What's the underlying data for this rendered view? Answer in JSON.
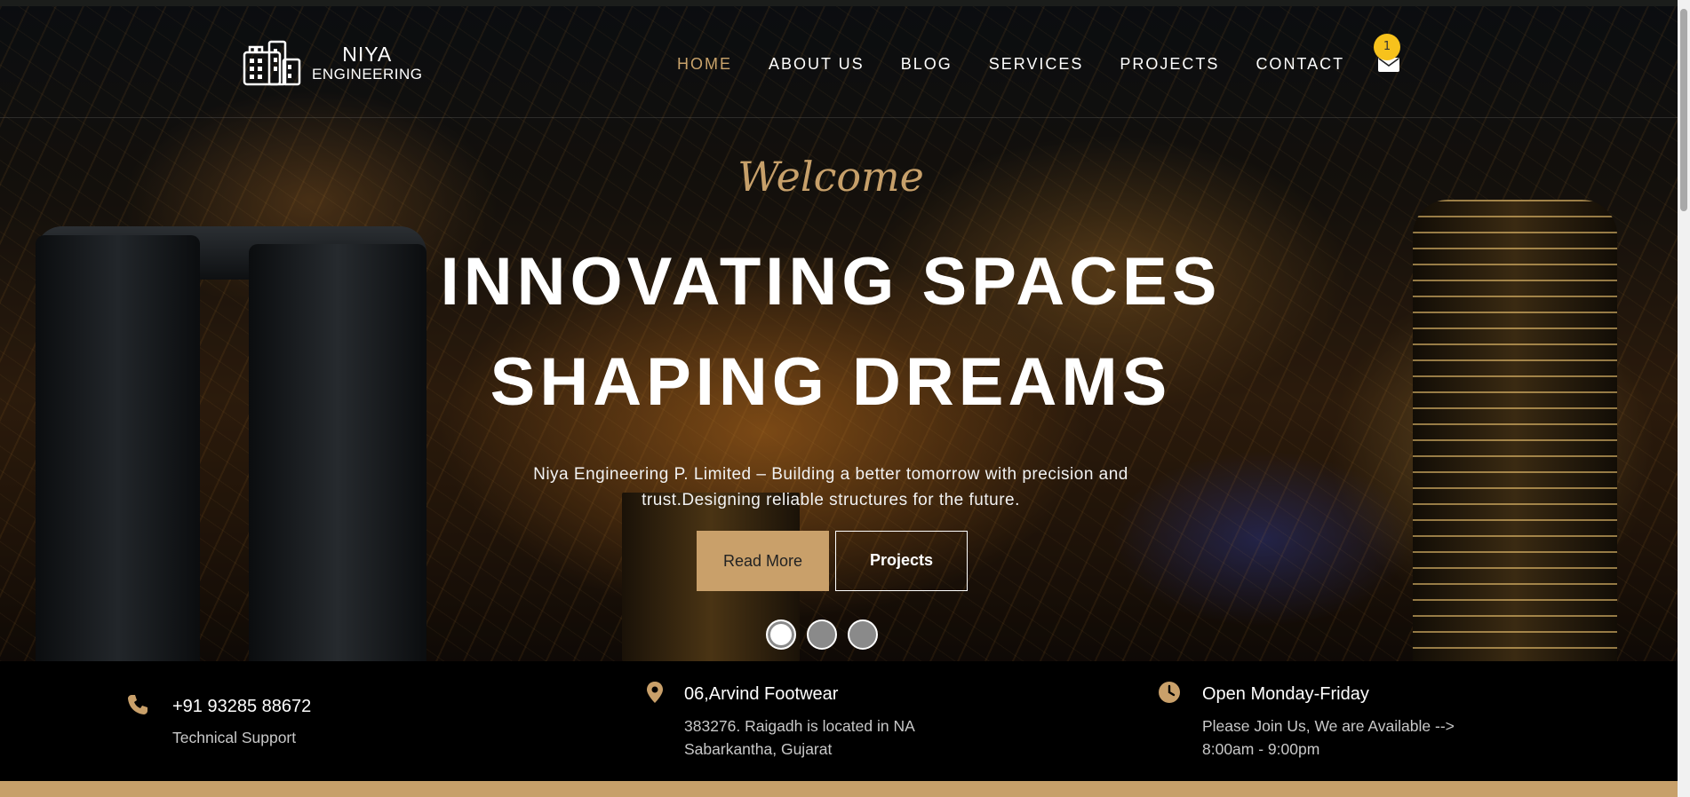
{
  "brand": {
    "name": "NIYA",
    "sub": "ENGINEERING"
  },
  "nav": {
    "items": [
      {
        "label": "HOME",
        "active": true
      },
      {
        "label": "ABOUT US"
      },
      {
        "label": "BLOG"
      },
      {
        "label": "SERVICES"
      },
      {
        "label": "PROJECTS"
      },
      {
        "label": "CONTACT"
      }
    ],
    "mail_badge": "1"
  },
  "hero": {
    "welcome": "Welcome",
    "headline_1": "INNOVATING SPACES",
    "headline_2": "SHAPING DREAMS",
    "subtitle": "Niya Engineering P. Limited – Building a better tomorrow with precision and trust.Designing reliable structures for the future.",
    "read_more": "Read More",
    "projects": "Projects",
    "slides": 3,
    "active_slide": 1
  },
  "info": {
    "phone": {
      "icon": "phone-icon",
      "title": "+91 93285 88672",
      "text": "Technical Support"
    },
    "address": {
      "icon": "map-pin-icon",
      "title": "06,Arvind Footwear",
      "line1": "383276. Raigadh is located in NA",
      "line2": "Sabarkantha, Gujarat"
    },
    "hours": {
      "icon": "clock-icon",
      "title": "Open Monday-Friday",
      "line1": "Please Join Us, We are Available -->",
      "line2": "8:00am - 9:00pm"
    }
  },
  "colors": {
    "accent": "#c9a06a",
    "badge": "#f7c21c",
    "info_bg": "#000000"
  }
}
